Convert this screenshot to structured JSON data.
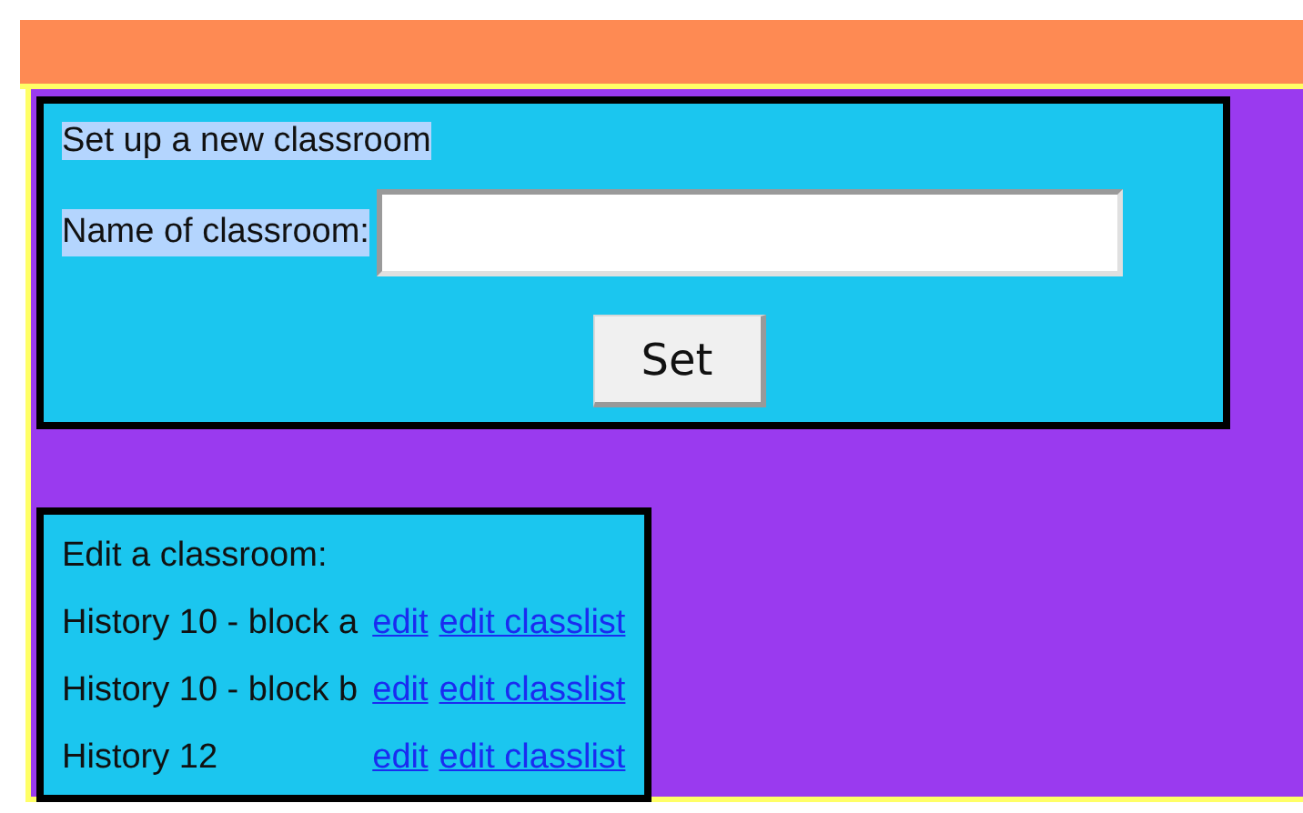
{
  "new_classroom": {
    "title": {
      "text": "Set up a new classroom",
      "highlighted": true
    },
    "name_label": {
      "text": "Name of classroom:",
      "highlighted": true
    },
    "set_button": "Set"
  },
  "edit_classroom": {
    "title": "Edit a classroom:",
    "rows": [
      {
        "name": "History 10 - block a",
        "links": [
          "edit",
          "edit classlist"
        ]
      },
      {
        "name": "History 10 - block b",
        "links": [
          "edit",
          "edit classlist"
        ]
      },
      {
        "name": "History 12",
        "links": [
          "edit",
          "edit classlist"
        ]
      }
    ]
  }
}
